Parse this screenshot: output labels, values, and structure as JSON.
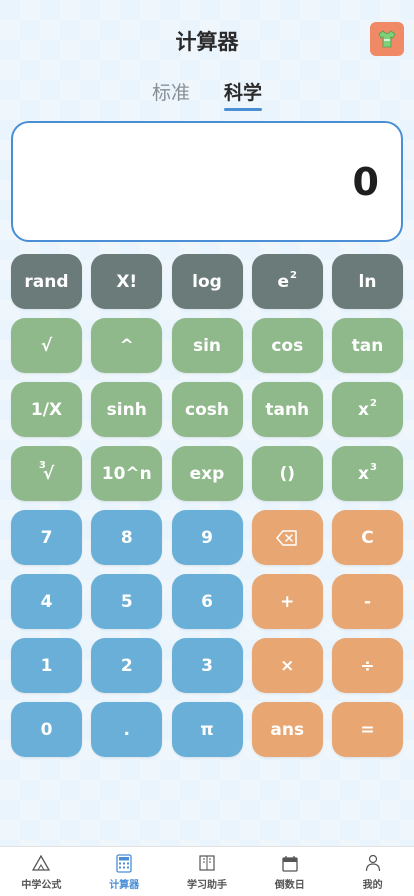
{
  "header": {
    "title": "计算器",
    "theme_icon": "tshirt-icon"
  },
  "tabs": [
    {
      "label": "标准",
      "active": false
    },
    {
      "label": "科学",
      "active": true
    }
  ],
  "display": {
    "value": "0"
  },
  "keys": {
    "row1": [
      "rand",
      "X!",
      "log",
      "e",
      "ln"
    ],
    "row2": [
      "√",
      "^",
      "sin",
      "cos",
      "tan"
    ],
    "row3": [
      "1/X",
      "sinh",
      "cosh",
      "tanh",
      "x"
    ],
    "row4": [
      "√",
      "10^n",
      "exp",
      "()",
      "x"
    ],
    "row5": [
      "7",
      "8",
      "9",
      "⌫",
      "C"
    ],
    "row6": [
      "4",
      "5",
      "6",
      "+",
      "-"
    ],
    "row7": [
      "1",
      "2",
      "3",
      "×",
      "÷"
    ],
    "row8": [
      "0",
      ".",
      "π",
      "ans",
      "="
    ],
    "superscripts": {
      "e_power": "2",
      "x_square": "2",
      "x_cube": "3",
      "cube_root_index": "3"
    }
  },
  "colors": {
    "accent": "#4a8fd6",
    "function_key": "#6b7b7a",
    "scientific_key": "#8fb98b",
    "number_key": "#6aafd7",
    "operator_key": "#e8a672"
  },
  "tabbar": [
    {
      "label": "中学公式",
      "icon": "triangle-icon",
      "active": false
    },
    {
      "label": "计算器",
      "icon": "calculator-icon",
      "active": true
    },
    {
      "label": "学习助手",
      "icon": "book-icon",
      "active": false
    },
    {
      "label": "倒数日",
      "icon": "calendar-icon",
      "active": false
    },
    {
      "label": "我的",
      "icon": "user-icon",
      "active": false
    }
  ]
}
